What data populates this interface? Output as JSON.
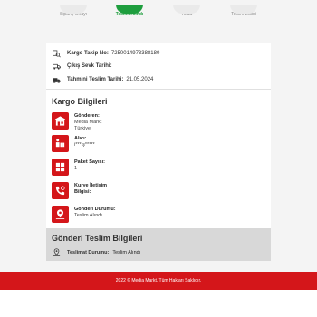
{
  "stepper": {
    "steps": [
      {
        "label": "Sipariş Onayı",
        "active": false
      },
      {
        "label": "Teslim Alındı",
        "active": true
      },
      {
        "label": "Yolda",
        "active": false
      },
      {
        "label": "Teslim Edildi",
        "active": false
      }
    ],
    "active_color": "#1e9e3e"
  },
  "tracking": {
    "tracking_no_label": "Kargo Takip No:",
    "tracking_no_value": "7250014973388180",
    "shipped_date_label": "Çıkış Sevk Tarihi:",
    "shipped_date_value": "",
    "estimated_date_label": "Tahmini Teslim Tarihi:",
    "estimated_date_value": "21.05.2024"
  },
  "cargo": {
    "title": "Kargo Bilgileri",
    "sender_label": "Gönderen:",
    "sender_value_line1": "Media Markt",
    "sender_value_line2": "Türkiye",
    "recipient_label": "Alıcı:",
    "recipient_value": "i*** ş*****",
    "package_count_label": "Paket Sayısı:",
    "package_count_value": "1",
    "courier_label_line1": "Kurye İletişim",
    "courier_label_line2": "Bilgisi:",
    "status_label": "Gönderi Durumu:",
    "status_value": "Teslim Alındı",
    "icon_color": "#d4161a"
  },
  "delivery": {
    "title": "Gönderi Teslim Bilgileri",
    "status_label": "Teslimat Durumu:",
    "status_value": "Teslim Alındı"
  },
  "footer": {
    "text": "2022 © Media Markt. Tüm Hakları Saklıdır."
  }
}
